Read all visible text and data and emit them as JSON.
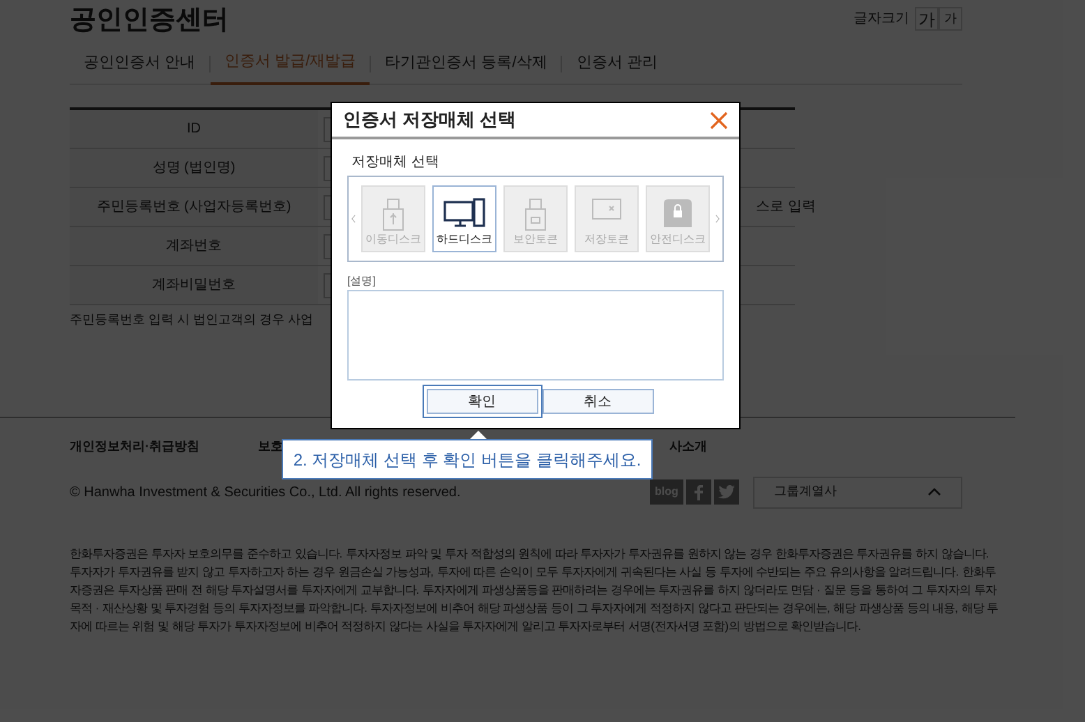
{
  "header": {
    "title": "공인인증센터",
    "font_size_label": "글자크기",
    "font_size_buttons": [
      "가",
      "가"
    ]
  },
  "tabs": [
    {
      "label": "공인인증서 안내",
      "selected": false
    },
    {
      "label": "인증서 발급/재발급",
      "selected": true
    },
    {
      "label": "타기관인증서 등록/삭제",
      "selected": false
    },
    {
      "label": "인증서 관리",
      "selected": false
    }
  ],
  "form": {
    "rows": [
      {
        "label": "ID"
      },
      {
        "label": "성명 (법인명)"
      },
      {
        "label": "주민등록번호 (사업자등록번호)",
        "trailing": "스로 입력"
      },
      {
        "label": "계좌번호"
      },
      {
        "label": "계좌비밀번호"
      }
    ],
    "note": "주민등록번호 입력 시 법인고객의 경우 사업"
  },
  "footer": {
    "links": [
      "개인정보처리·취급방침",
      "보호",
      "사소개"
    ],
    "copyright": "© Hanwha Investment & Securities Co., Ltd. All rights reserved.",
    "social": [
      {
        "kind": "blog",
        "label": "blog"
      },
      {
        "kind": "facebook"
      },
      {
        "kind": "twitter"
      }
    ],
    "group_select": "그룹계열사",
    "disclaimer": "한화투자증권은 투자자 보호의무를 준수하고 있습니다. 투자자정보 파악 및 투자 적합성의 원칙에 따라 투자자가 투자권유를 원하지 않는 경우 한화투자증권은 투자권유를 하지 않습니다. 투자자가 투자권유를 받지 않고 투자하고자 하는 경우 원금손실 가능성과, 투자에 따른 손익이 모두 투자자에게 귀속된다는 사실 등 투자에 수반되는 주요 유의사항을 알려드립니다. 한화투자증권은 투자상품 판매 전 해당 투자설명서를 투자자에게 교부합니다. 투자자에게 파생상품등을 판매하려는 경우에는 투자권유를 하지 않더라도 면담 · 질문 등을 통하여 그 투자자의 투자목적 · 재산상황 및 투자경험 등의 투자자정보를 파악합니다. 투자자정보에 비추어 해당 파생상품 등이 그 투자자에게 적정하지 않다고 판단되는 경우에는, 해당 파생상품 등의 내용, 해당 투자에 따르는 위험 및 해당 투자가 투자자정보에 비추어 적정하지 않다는 사실을 투자자에게 알리고 투자자로부터 서명(전자서명 포함)의 방법으로 확인받습니다."
  },
  "dialog": {
    "title": "인증서 저장매체 선택",
    "section_label": "저장매체 선택",
    "media": [
      {
        "kind": "usb",
        "label": "이동디스크",
        "selected": false
      },
      {
        "kind": "monitor",
        "label": "하드디스크",
        "selected": true
      },
      {
        "kind": "token",
        "label": "보안토큰",
        "selected": false
      },
      {
        "kind": "card",
        "label": "저장토큰",
        "selected": false
      },
      {
        "kind": "disk",
        "label": "안전디스크",
        "selected": false
      }
    ],
    "description_label": "[설명]",
    "buttons": [
      "확인",
      "취소"
    ]
  },
  "callout": {
    "text": "2. 저장매체 선택 후 확인 버튼을 클릭해주세요."
  }
}
